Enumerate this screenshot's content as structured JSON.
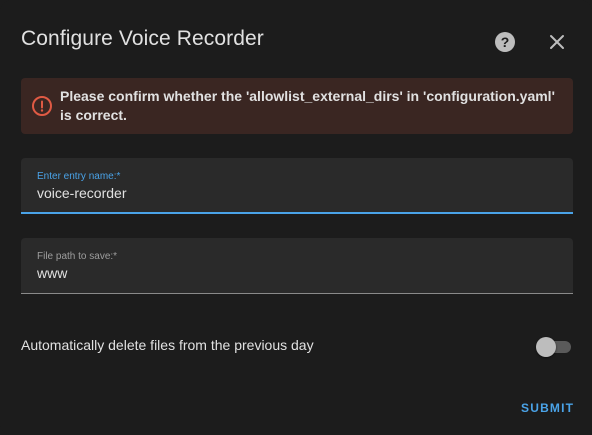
{
  "dialog": {
    "title": "Configure Voice Recorder"
  },
  "header": {
    "help_icon": "help-circle-icon",
    "close_icon": "close-icon"
  },
  "alert": {
    "icon": "error-outline-icon",
    "message": "Please confirm whether the 'allowlist_external_dirs' in 'configuration.yaml' is correct.",
    "color": "#e05a44",
    "background": "#3a2622"
  },
  "form": {
    "entry_name": {
      "label": "Enter entry name:*",
      "value": "voice-recorder"
    },
    "file_path": {
      "label": "File path to save:*",
      "value": "www"
    },
    "auto_delete": {
      "label": "Automatically delete files from the previous day",
      "enabled": false
    }
  },
  "actions": {
    "submit_label": "SUBMIT"
  },
  "colors": {
    "accent": "#4aa3e8",
    "background": "#1c1c1c",
    "field": "#2a2a2a",
    "text": "#e1e1e1"
  }
}
